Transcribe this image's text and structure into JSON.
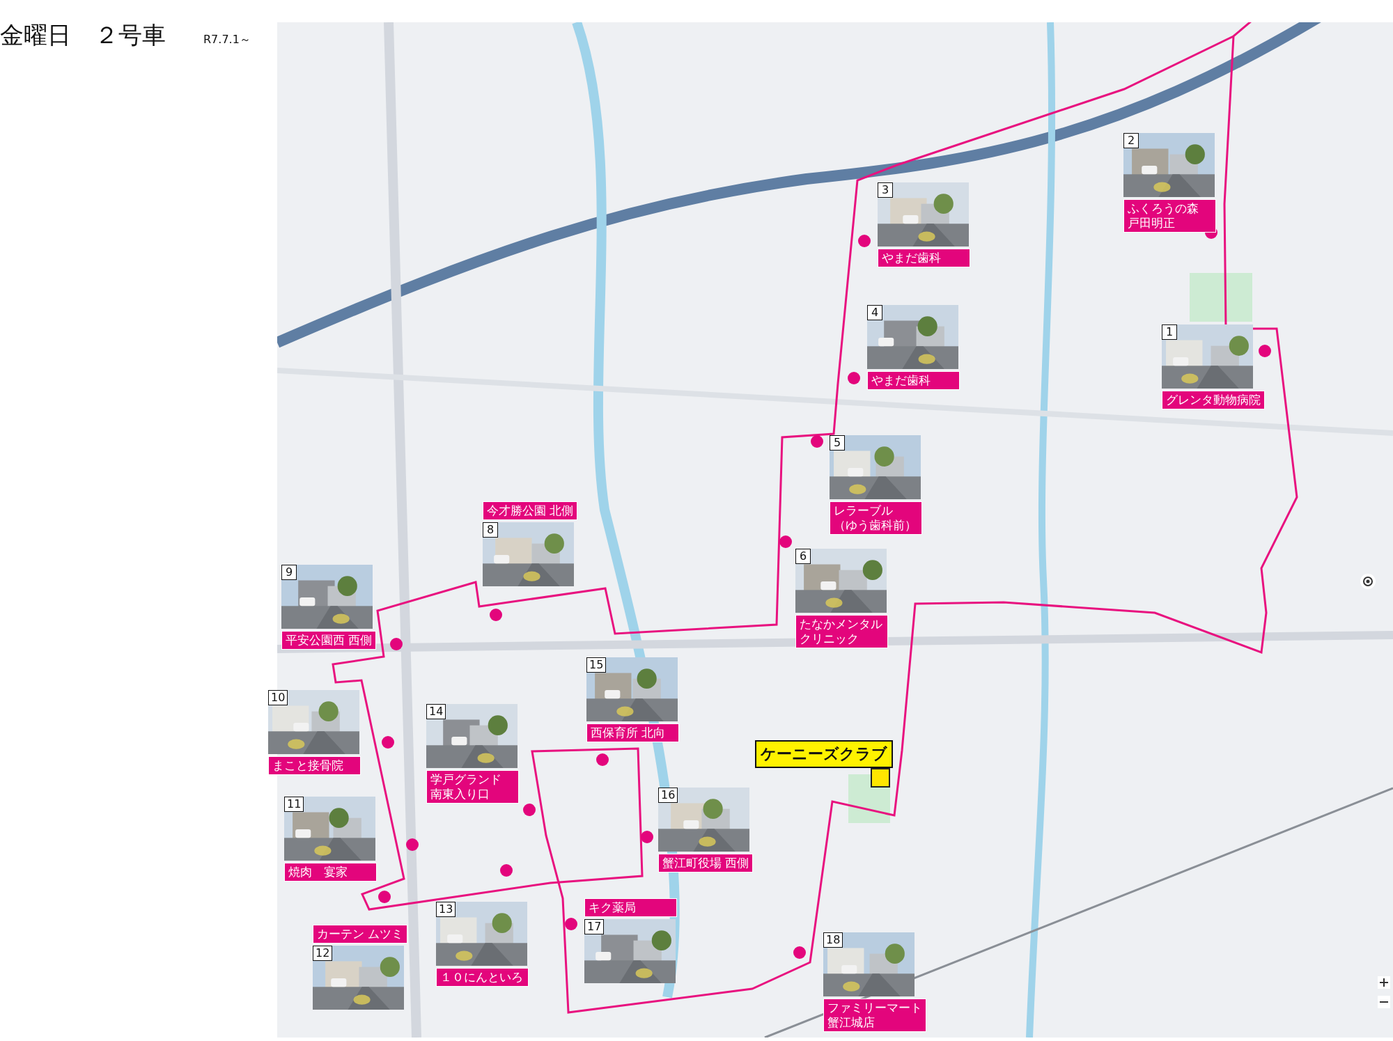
{
  "header": {
    "title": "金曜日　２号車",
    "date": "R7.7.1～"
  },
  "destination": {
    "name": "ケーニーズクラブ"
  },
  "stops": [
    {
      "number": "1",
      "lines": [
        "グレンタ動物病院"
      ]
    },
    {
      "number": "2",
      "lines": [
        "ふくろうの森",
        "戸田明正"
      ]
    },
    {
      "number": "3",
      "lines": [
        "やまだ歯科"
      ]
    },
    {
      "number": "4",
      "lines": [
        "やまだ歯科"
      ]
    },
    {
      "number": "5",
      "lines": [
        "レラーブル",
        "（ゆう歯科前）"
      ]
    },
    {
      "number": "6",
      "lines": [
        "たなかメンタル",
        "クリニック"
      ]
    },
    {
      "number": "8",
      "lines": [
        "今才勝公園 北側"
      ]
    },
    {
      "number": "9",
      "lines": [
        "平安公園西 西側"
      ]
    },
    {
      "number": "10",
      "lines": [
        "まこと接骨院"
      ]
    },
    {
      "number": "11",
      "lines": [
        "焼肉　宴家"
      ]
    },
    {
      "number": "12",
      "lines": [
        "カーテン ムツミ"
      ]
    },
    {
      "number": "14",
      "lines": [
        "学戸グランド",
        "南東入り口"
      ]
    },
    {
      "number": "13",
      "lines": [
        "１０にんといろ"
      ]
    },
    {
      "number": "15",
      "lines": [
        "西保育所 北向"
      ]
    },
    {
      "number": "16",
      "lines": [
        "蟹江町役場 西側"
      ]
    },
    {
      "number": "17",
      "lines": [
        "キク薬局"
      ]
    },
    {
      "number": "18",
      "lines": [
        "ファミリーマート",
        "蟹江城店"
      ]
    }
  ]
}
